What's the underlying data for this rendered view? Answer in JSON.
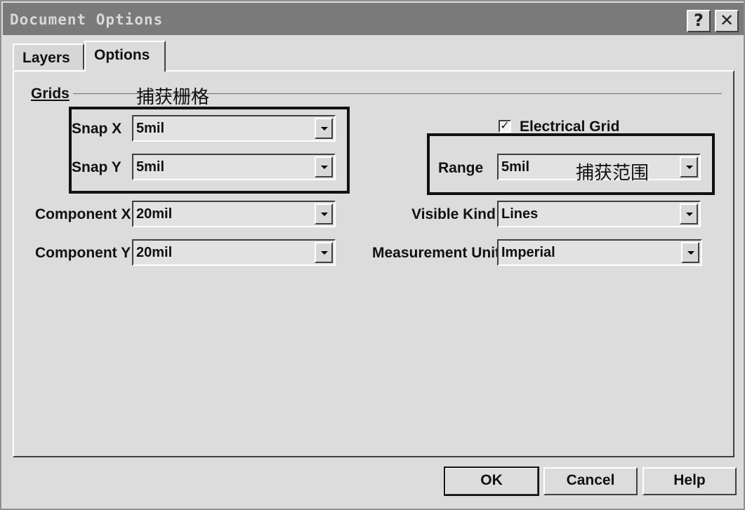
{
  "window": {
    "title": "Document Options",
    "help_glyph": "?",
    "close_glyph": "✕"
  },
  "tabs": [
    {
      "label": "Layers"
    },
    {
      "label": "Options"
    }
  ],
  "grids": {
    "label": "Grids",
    "annotation": "捕获栅格",
    "snap_x": {
      "label": "Snap X",
      "value": "5mil"
    },
    "snap_y": {
      "label": "Snap Y",
      "value": "5mil"
    },
    "component_x": {
      "label": "Component X",
      "value": "20mil"
    },
    "component_y": {
      "label": "Component Y",
      "value": "20mil"
    }
  },
  "electrical": {
    "checkbox_label": "Electrical Grid",
    "checked": true,
    "check_glyph": "✓",
    "range": {
      "label": "Range",
      "value": "5mil"
    },
    "annotation": "捕获范围"
  },
  "visible_kind": {
    "label": "Visible Kind",
    "value": "Lines"
  },
  "measurement_unit": {
    "label": "Measurement Unit",
    "value": "Imperial"
  },
  "buttons": {
    "ok": "OK",
    "cancel": "Cancel",
    "help": "Help"
  }
}
